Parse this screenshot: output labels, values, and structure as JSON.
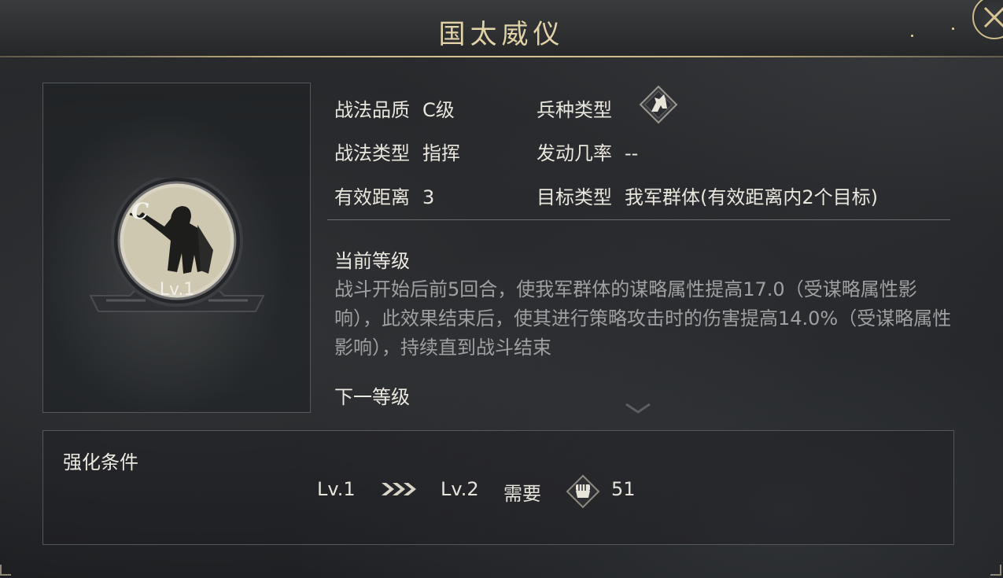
{
  "header": {
    "title": "国太威仪"
  },
  "skill": {
    "grade_letter": "C",
    "level": "Lv.1"
  },
  "info": {
    "quality_label": "战法品质",
    "quality_value": "C级",
    "troop_label": "兵种类型",
    "troop_icon": "cavalry-horse-icon",
    "type_label": "战法类型",
    "type_value": "指挥",
    "chance_label": "发动几率",
    "chance_value": "--",
    "range_label": "有效距离",
    "range_value": "3",
    "target_label": "目标类型",
    "target_value": "我军群体(有效距离内2个目标)"
  },
  "current_level": {
    "title": "当前等级",
    "description": "战斗开始后前5回合，使我军群体的谋略属性提高17.0（受谋略属性影响），此效果结束后，使其进行策略攻击时的伤害提高14.0%（受谋略属性影响），持续直到战斗结束"
  },
  "next_level": {
    "title": "下一等级"
  },
  "upgrade": {
    "title": "强化条件",
    "from_level": "Lv.1",
    "to_level": "Lv.2",
    "need_label": "需要",
    "cost_icon": "fist-icon",
    "cost_value": "51"
  },
  "colors": {
    "gold_accent": "#c9b583",
    "title_text": "#e2d2a8",
    "body_text": "#e9e6dd",
    "description_text": "#9fa0a1"
  }
}
